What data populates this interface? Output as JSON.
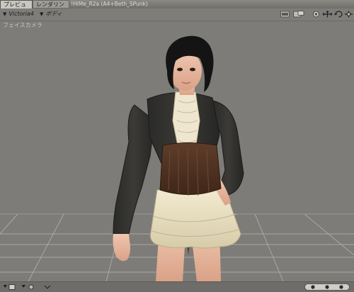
{
  "tabs": [
    {
      "label": "プレビュー",
      "active": true
    },
    {
      "label": "レンダリング",
      "active": false
    }
  ],
  "document_title": "!HiMe_R2a (A4+Beth_SPunk)",
  "toolbar": {
    "figure_dropdown": "Victoria4",
    "part_dropdown": "ボディ",
    "icons": [
      "render-icon",
      "render-settings-icon",
      "camera-icon",
      "move-cross-icon",
      "rotate-icon",
      "pan-icon"
    ]
  },
  "viewport": {
    "camera_label": "フェイスカメラ",
    "background_color": "#7d7c78",
    "grid_color": "#a8a7a2"
  },
  "bottombar": {
    "icons": [
      "display-style-icon",
      "light-icon",
      "ground-icon",
      "orbit-icon"
    ]
  }
}
